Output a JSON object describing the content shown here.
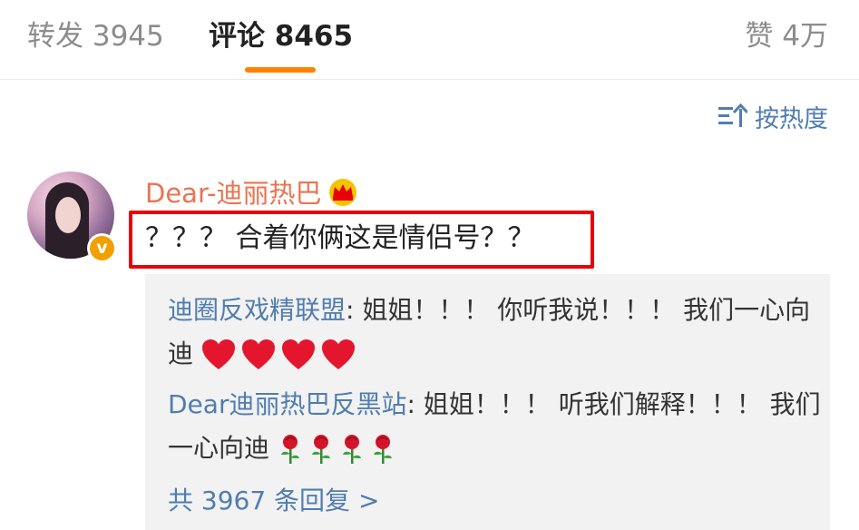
{
  "tabs": {
    "repost": "转发 3945",
    "comments": "评论 8465",
    "likes": "赞 4万"
  },
  "sort": {
    "label": "按热度",
    "icon": "sort-icon"
  },
  "comment": {
    "username": "Dear-迪丽热巴",
    "user_badge_icon": "crown-icon",
    "verified_badge": "v",
    "text": "？？？ 合着你俩这是情侣号？？"
  },
  "replies": [
    {
      "name": "迪圈反戏精联盟",
      "text": ": 姐姐！！！ 你听我说！！！ 我们一心向迪",
      "emoji": "heart-icon",
      "emoji_count": 4
    },
    {
      "name": "Dear迪丽热巴反黑站",
      "text": ": 姐姐！！！ 听我们解释！！！ 我们一心向迪",
      "emoji": "rose-icon",
      "emoji_count": 4
    }
  ],
  "more_replies": "共 3967 条回复 >",
  "colors": {
    "accent": "#ff8200",
    "link": "#507daf",
    "username": "#eb7350",
    "highlight_box": "#e8000c",
    "verified": "#f29f00"
  }
}
